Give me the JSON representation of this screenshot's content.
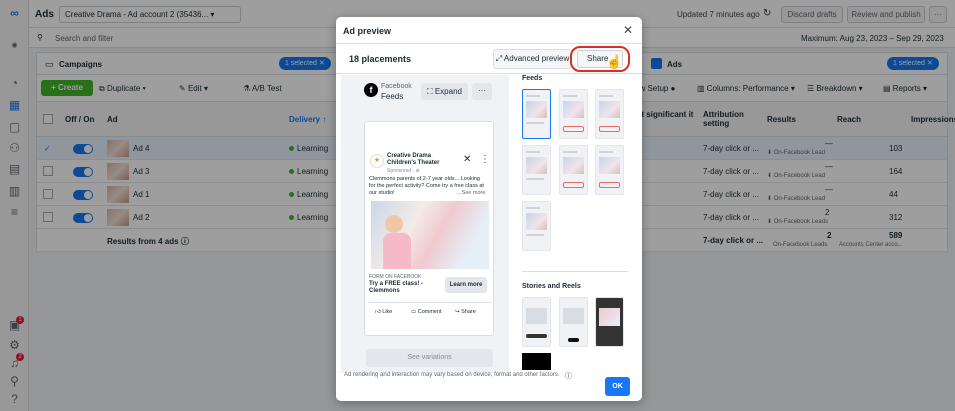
{
  "topbar": {
    "title": "Ads",
    "account": "Creative Drama - Ad account 2 (35436...",
    "updated": "Updated 7 minutes ago",
    "discard": "Discard drafts",
    "review": "Review and publish"
  },
  "search": {
    "placeholder": "Search and filter",
    "date_range": "Maximum: Aug 23, 2023 – Sep 29, 2023"
  },
  "campaigns": {
    "tab_label": "Campaigns",
    "selected_pill": "1 selected",
    "ads_tab": "Ads",
    "ads_selected": "1 selected",
    "toolbar": {
      "create": "+ Create",
      "duplicate": "Duplicate",
      "edit": "Edit",
      "ab_test": "A/B Test",
      "view_setup": "ew Setup",
      "columns": "Columns: Performance",
      "breakdown": "Breakdown",
      "reports": "Reports"
    },
    "headers": {
      "onoff": "Off / On",
      "ad": "Ad",
      "delivery": "Delivery ↑",
      "significant": "st significant\nit",
      "attribution": "Attribution setting",
      "results": "Results",
      "reach": "Reach",
      "impressions": "Impressions"
    },
    "rows": [
      {
        "name": "Ad 4",
        "delivery": "Learning",
        "attribution": "7-day click or ...",
        "results_top": "—",
        "results": "On-Facebook Lead",
        "reach": "103"
      },
      {
        "name": "Ad 3",
        "delivery": "Learning",
        "attribution": "7-day click or ...",
        "results_top": "—",
        "results": "On-Facebook Lead",
        "reach": "164"
      },
      {
        "name": "Ad 1",
        "delivery": "Learning",
        "attribution": "7-day click or ...",
        "results_top": "—",
        "results": "On-Facebook Lead",
        "reach": "44"
      },
      {
        "name": "Ad 2",
        "delivery": "Learning",
        "attribution": "7-day click or ...",
        "results_top": "2",
        "results": "On-Facebook Leads",
        "reach": "312"
      }
    ],
    "summary": {
      "label": "Results from 4 ads",
      "attribution": "7-day click or ...",
      "results_top": "2",
      "results": "On-Facebook Leads",
      "reach": "589",
      "reach_sub": "Accounts Center acco..."
    }
  },
  "modal": {
    "title": "Ad preview",
    "placements": "18 placements",
    "advanced": "Advanced preview",
    "share": "Share",
    "platform": "Facebook",
    "platform_sub": "Feeds",
    "expand": "Expand",
    "feeds_label": "Feeds",
    "stories_label": "Stories and Reels",
    "see_variations": "See variations",
    "disclaimer": "Ad rendering and interaction may vary based on device, format and other factors.",
    "ok": "OK",
    "post": {
      "page_name": "Creative Drama Children's Theater",
      "sponsored": "Sponsored · ⊕",
      "body": "Clemmons parents of 2-7 year olds... Looking for the perfect activity? Come try a free class at our studio!",
      "see_more": "...See more",
      "form_label": "FORM ON FACEBOOK",
      "headline": "Try a FREE class! - Clemmons",
      "cta": "Learn more",
      "like": "Like",
      "comment": "Comment",
      "share": "Share"
    }
  },
  "colors": {
    "brand": "#1877f2",
    "green": "#42b72a",
    "highlight": "#d93025"
  }
}
